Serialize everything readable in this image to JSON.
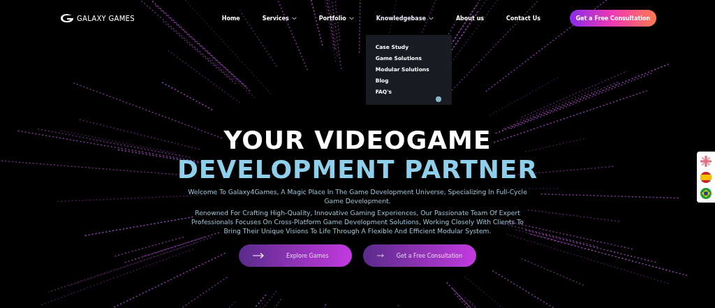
{
  "logo": {
    "text": "GALAXY GAMES"
  },
  "nav": [
    {
      "label": "Home",
      "has_dropdown": false,
      "expanded": false
    },
    {
      "label": "Services",
      "has_dropdown": true,
      "expanded": false
    },
    {
      "label": "Portfolio",
      "has_dropdown": true,
      "expanded": false
    },
    {
      "label": "Knowledgebase",
      "has_dropdown": true,
      "expanded": true,
      "menu": [
        "Case Study",
        "Game Solutions",
        "Modular Solutions",
        "Blog",
        "FAQ's"
      ]
    },
    {
      "label": "About us",
      "has_dropdown": false,
      "expanded": false
    },
    {
      "label": "Contact Us",
      "has_dropdown": false,
      "expanded": false
    }
  ],
  "cta": {
    "label": "Get a Free Consultation"
  },
  "hero": {
    "title_lines": [
      {
        "text": "YOUR VIDEOGAME",
        "kind": "plain"
      },
      {
        "text": "DEVELOPMENT PARTNER",
        "kind": "accent"
      }
    ],
    "paragraphs": [
      "Welcome To Galaxy4Games, A Magic Place In The Game Development Universe, Specializing In Full-Cycle Game Development.",
      "Renowned For Crafting High-Quality, Innovative Gaming Experiences, Our Passionate Team Of Expert Professionals Focuses On Cross-Platform Game Development Solutions, Working Closely With Clients To Bring Their Unique Visions To Life Through A Flexible And Efficient Modular System."
    ],
    "buttons": [
      {
        "label": "Explore Games"
      },
      {
        "label": "Get a Free Consultation"
      }
    ]
  }
}
